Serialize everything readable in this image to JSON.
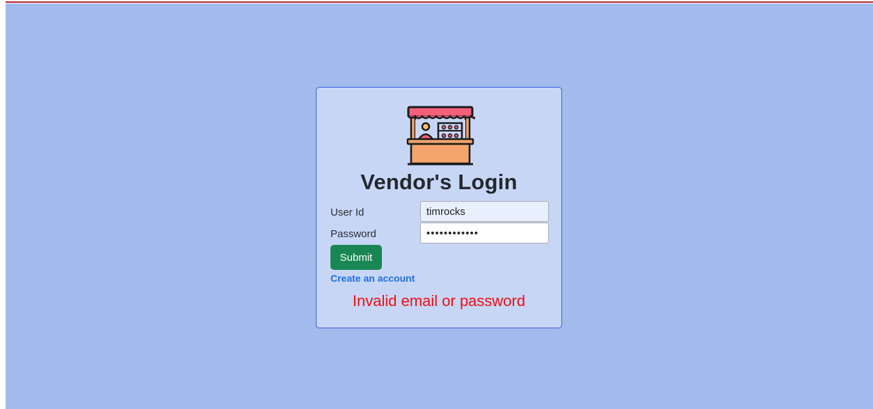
{
  "login": {
    "title": "Vendor's Login",
    "user_label": "User Id",
    "user_value": "timrocks",
    "password_label": "Password",
    "password_value": "timrockspass",
    "submit_label": "Submit",
    "create_account_label": "Create an account",
    "error_message": "Invalid email or password",
    "logo_icon": "vendor-stall-icon"
  },
  "colors": {
    "page_background": "#a2bbec",
    "card_background": "#c8d6f6",
    "card_border": "#3d5be6",
    "submit_button": "#198754",
    "link": "#1f6fe0",
    "error": "#f20d0d",
    "top_accent": "#b3262b"
  }
}
